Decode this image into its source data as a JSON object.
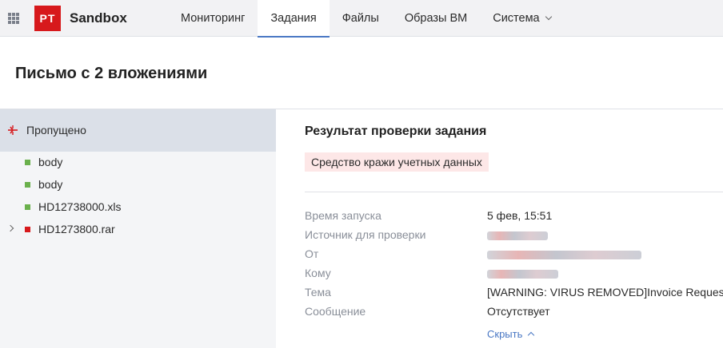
{
  "header": {
    "logo_text": "PT",
    "brand": "Sandbox",
    "nav": [
      {
        "label": "Мониторинг",
        "active": false
      },
      {
        "label": "Задания",
        "active": true
      },
      {
        "label": "Файлы",
        "active": false
      },
      {
        "label": "Образы ВМ",
        "active": false
      },
      {
        "label": "Система",
        "active": false
      }
    ]
  },
  "page": {
    "title": "Письмо с 2 вложениями"
  },
  "tree": {
    "root_label": "Пропущено",
    "items": [
      {
        "name": "body",
        "status_color": "#6ab04c"
      },
      {
        "name": "body",
        "status_color": "#6ab04c"
      },
      {
        "name": "HD12738000.xls",
        "status_color": "#6ab04c"
      },
      {
        "name": "HD1273800.rar",
        "status_color": "#d7191c"
      }
    ]
  },
  "result": {
    "title": "Результат проверки задания",
    "threat": "Средство кражи учетных данных",
    "fields": {
      "start_time_label": "Время запуска",
      "start_time_value": "5 фев, 15:51",
      "source_label": "Источник для проверки",
      "from_label": "От",
      "to_label": "Кому",
      "subject_label": "Тема",
      "subject_value": "[WARNING: VIRUS REMOVED]Invoice Request",
      "message_label": "Сообщение",
      "message_value": "Отсутствует"
    },
    "hide_link": "Скрыть"
  },
  "colors": {
    "accent": "#4a78c4",
    "brand_red": "#d7191c",
    "ok_green": "#6ab04c"
  }
}
